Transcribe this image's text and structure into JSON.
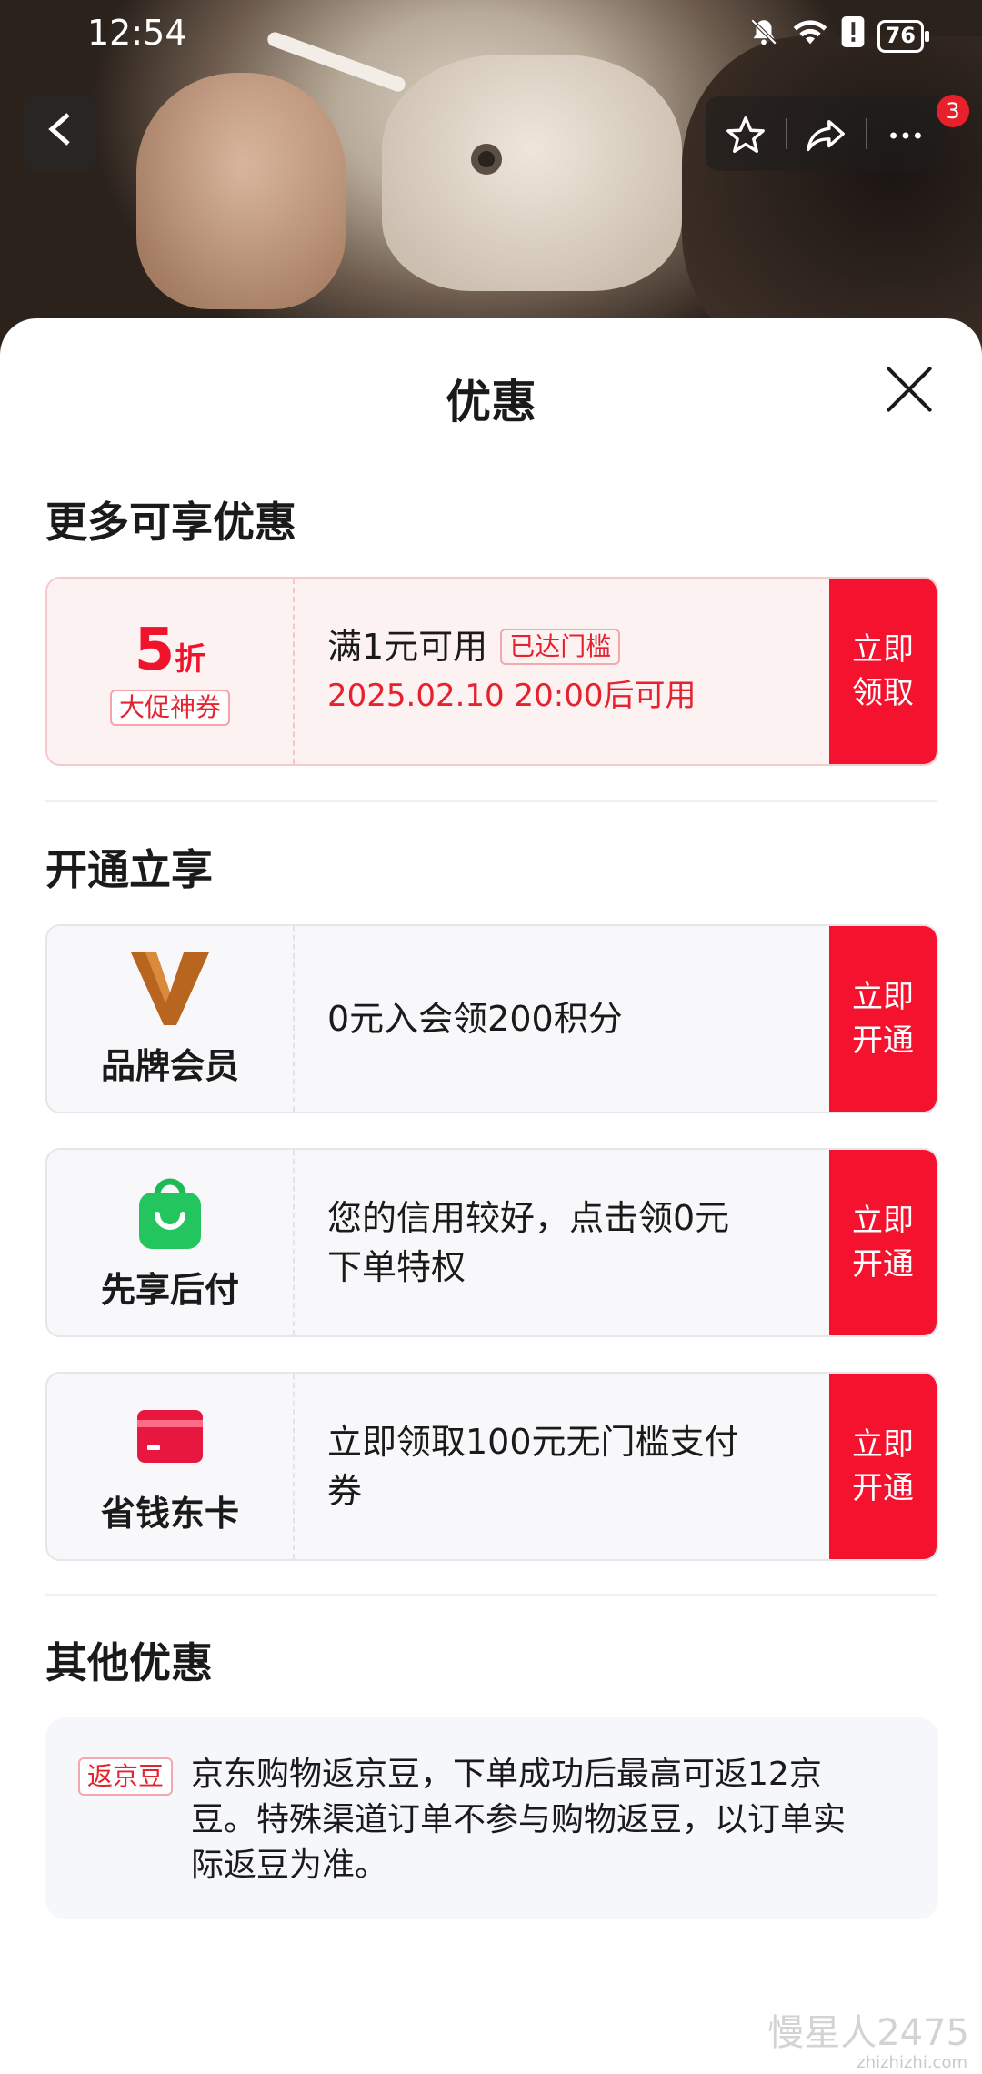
{
  "status_bar": {
    "time": "12:54",
    "battery": "76"
  },
  "header": {
    "badge_count": "3"
  },
  "sheet": {
    "title": "优惠",
    "more_section": {
      "title": "更多可享优惠",
      "coupon": {
        "discount_value": "5",
        "discount_unit": "折",
        "tag": "大促神券",
        "condition": "满1元可用",
        "threshold_tag": "已达门槛",
        "valid_time": "2025.02.10 20:00后可用",
        "cta_line1": "立即",
        "cta_line2": "领取"
      }
    },
    "open_section": {
      "title": "开通立享",
      "items": [
        {
          "name": "品牌会员",
          "desc_line1": "0元入会领200积分",
          "desc_line2": "",
          "cta_line1": "立即",
          "cta_line2": "开通",
          "icon": "brand-v-icon"
        },
        {
          "name": "先享后付",
          "desc_line1": "您的信用较好，点击领0元",
          "desc_line2": "下单特权",
          "cta_line1": "立即",
          "cta_line2": "开通",
          "icon": "shopping-bag-icon"
        },
        {
          "name": "省钱东卡",
          "desc_line1": "立即领取100元无门槛支付",
          "desc_line2": "券",
          "cta_line1": "立即",
          "cta_line2": "开通",
          "icon": "card-icon"
        }
      ]
    },
    "other_section": {
      "title": "其他优惠",
      "tag": "返京豆",
      "text_line1": "京东购物返京豆，下单成功后最高可返12京",
      "text_line2": "豆。特殊渠道订单不参与购物返豆，以订单实",
      "text_line3": "际返豆为准。"
    }
  },
  "colors": {
    "accent": "#f5122f",
    "accent_text": "#e5232f",
    "coupon_bg": "#fdf2f2",
    "card_bg": "#f8f8fa"
  },
  "watermark": {
    "main": "慢星人2475",
    "site": "zhizhizhi.com"
  }
}
